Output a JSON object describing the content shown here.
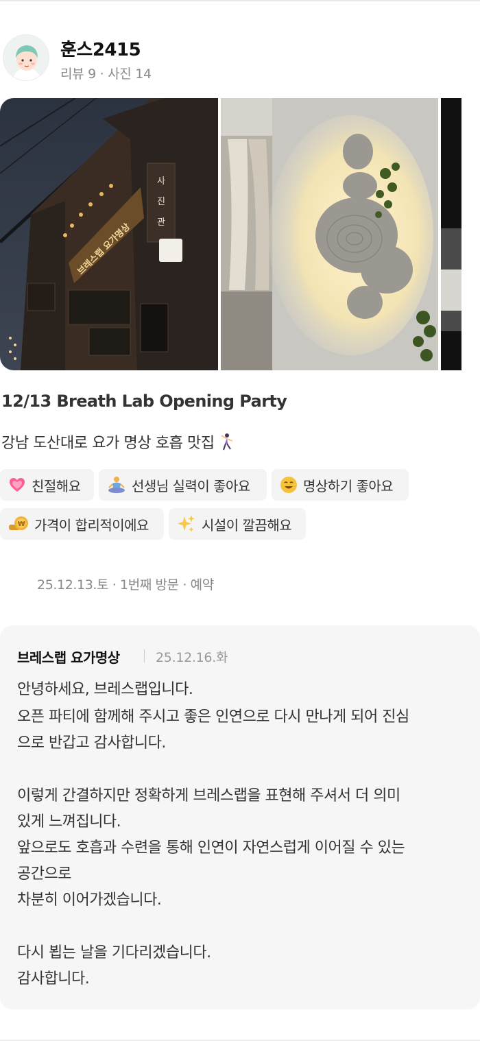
{
  "user": {
    "name": "훈스2415",
    "stats": "리뷰 9 · 사진 14"
  },
  "photos": [
    {
      "icon": "building-exterior-night-photo",
      "sign": "브레스랩 요가명상",
      "sign2": "사진관"
    },
    {
      "icon": "wall-lamp-stone-photo"
    },
    {
      "icon": "partial-photo"
    }
  ],
  "review": {
    "title": "12/13 Breath Lab Opening Party",
    "text": "강남 도산대로 요가 명상 호흡 맛집",
    "text_emoji": "dancing-person-icon",
    "tags": [
      {
        "label": "친절해요",
        "icon": "heart-icon",
        "color": "#ff5c93"
      },
      {
        "label": "선생님 실력이 좋아요",
        "icon": "meditating-person-icon",
        "color": "#f1b04a"
      },
      {
        "label": "명상하기 좋아요",
        "icon": "smiling-face-icon",
        "color": "#f5c33b"
      },
      {
        "label": "가격이 합리적이에요",
        "icon": "coin-icon",
        "color": "#f2b233"
      },
      {
        "label": "시설이 깔끔해요",
        "icon": "sparkles-icon",
        "color": "#f7c948"
      }
    ],
    "visit_info": "25.12.13.토 · 1번째 방문 · 예약"
  },
  "reply": {
    "owner": "브레스랩 요가명상",
    "date": "25.12.16.화",
    "lines": [
      "안녕하세요, 브레스랩입니다.",
      "오픈 파티에 함께해 주시고 좋은 인연으로 다시 만나게 되어 진심",
      "으로 반갑고 감사합니다.",
      "",
      "이렇게 간결하지만 정확하게 브레스랩을 표현해 주셔서 더 의미",
      "있게 느껴집니다.",
      "앞으로도 호흡과 수련을 통해 인연이 자연스럽게 이어질 수 있는",
      "공간으로",
      "차분히 이어가겠습니다.",
      "",
      "다시 뵙는 날을 기다리겠습니다.",
      "감사합니다."
    ]
  }
}
